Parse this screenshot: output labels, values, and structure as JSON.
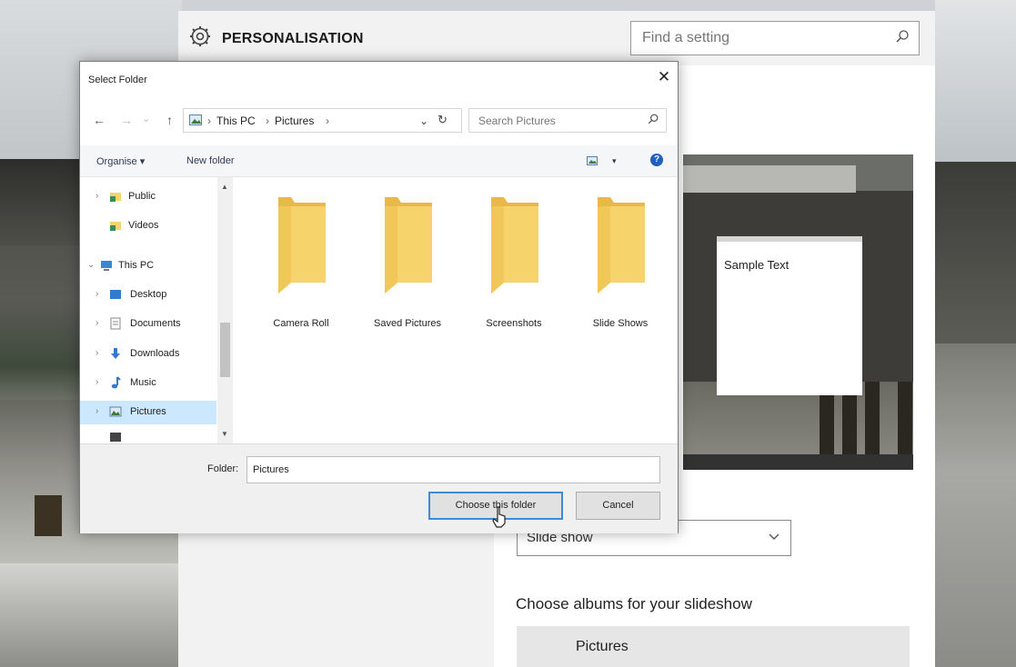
{
  "settings": {
    "title": "PERSONALISATION",
    "search_placeholder": "Find a setting",
    "preview_sample_text": "Sample Text",
    "background_value": "Slide show",
    "albums_label": "Choose albums for your slideshow",
    "album_item": "Pictures"
  },
  "dialog": {
    "title": "Select Folder",
    "close_glyph": "✕",
    "nav": {
      "back": "←",
      "forward": "→",
      "recent": "⌄",
      "up": "↑"
    },
    "breadcrumb": [
      "This PC",
      "Pictures"
    ],
    "breadcrumb_sep": "›",
    "refresh_glyph": "↻",
    "dropdown_glyph": "⌄",
    "search_placeholder": "Search Pictures",
    "toolbar": {
      "organise": "Organise ▾",
      "new_folder": "New folder",
      "view_glyph": "▾",
      "help_glyph": "?"
    },
    "tree": [
      {
        "label": "Public",
        "expand": "›",
        "icon": "public-folder-icon"
      },
      {
        "label": "Videos",
        "expand": "",
        "icon": "videos-folder-icon"
      },
      {
        "label": "This PC",
        "expand": "⌄",
        "icon": "this-pc-icon"
      },
      {
        "label": "Desktop",
        "expand": "›",
        "icon": "desktop-icon"
      },
      {
        "label": "Documents",
        "expand": "›",
        "icon": "documents-icon"
      },
      {
        "label": "Downloads",
        "expand": "›",
        "icon": "downloads-icon"
      },
      {
        "label": "Music",
        "expand": "›",
        "icon": "music-icon"
      },
      {
        "label": "Pictures",
        "expand": "›",
        "icon": "pictures-icon",
        "selected": true
      }
    ],
    "scroll": {
      "up": "▲",
      "down": "▼"
    },
    "folders": [
      "Camera Roll",
      "Saved Pictures",
      "Screenshots",
      "Slide Shows"
    ],
    "folder_field_label": "Folder:",
    "folder_field_value": "Pictures",
    "choose_button": "Choose this folder",
    "cancel_button": "Cancel"
  },
  "colors": {
    "accent": "#3b8bd8",
    "folder": "#f6d36b",
    "selection": "#cce8ff"
  }
}
